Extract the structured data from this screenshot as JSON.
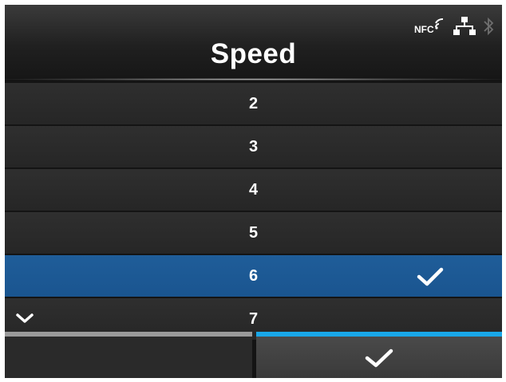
{
  "header": {
    "title": "Speed",
    "status_icons": [
      "nfc-icon",
      "network-icon",
      "bluetooth-icon"
    ],
    "nfc_text": "NFC"
  },
  "list": {
    "items": [
      {
        "label": "2",
        "selected": false
      },
      {
        "label": "3",
        "selected": false
      },
      {
        "label": "4",
        "selected": false
      },
      {
        "label": "5",
        "selected": false
      },
      {
        "label": "6",
        "selected": true
      },
      {
        "label": "7",
        "selected": false
      }
    ],
    "selected_value": "6"
  },
  "footer": {
    "left_button_icon": "none",
    "right_button_icon": "check-icon"
  },
  "colors": {
    "selection": "#1f5d99",
    "confirm_accent": "#19a7e8",
    "background": "#141414"
  }
}
